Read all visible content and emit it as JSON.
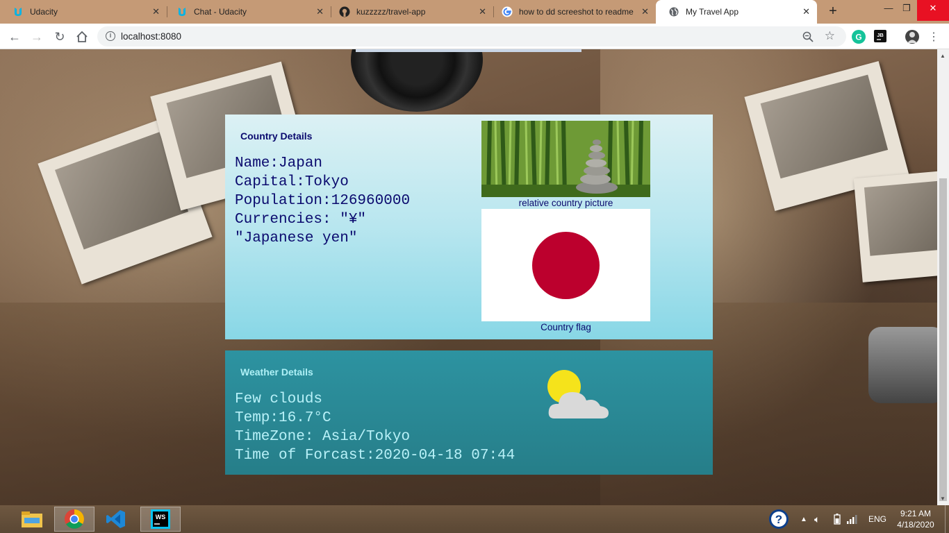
{
  "browser": {
    "tabs": [
      {
        "label": "Udacity",
        "icon": "udacity-icon",
        "active": false
      },
      {
        "label": "Chat - Udacity",
        "icon": "udacity-icon",
        "active": false
      },
      {
        "label": "kuzzzzz/travel-app",
        "icon": "github-icon",
        "active": false
      },
      {
        "label": "how to dd screeshot to readme",
        "icon": "google-icon",
        "active": false
      },
      {
        "label": "My Travel App",
        "icon": "globe-icon",
        "active": true
      }
    ],
    "url": "localhost:8080"
  },
  "country": {
    "heading": "Country Details",
    "name_line": "Name:Japan",
    "capital_line": "Capital:Tokyo",
    "population_line": "Population:126960000",
    "currencies_line1": "Currencies: \"¥\"",
    "currencies_line2": "\"Japanese yen\"",
    "picture_caption": "relative country picture",
    "flag_caption": "Country flag"
  },
  "weather": {
    "heading": "Weather Details",
    "description": "Few clouds",
    "temp_line": "Temp:16.7°C",
    "timezone_line": "TimeZone: Asia/Tokyo",
    "forecast_line": "Time of Forcast:2020-04-18 07:44",
    "icon": "sun-behind-cloud-icon"
  },
  "taskbar": {
    "apps": [
      "file-explorer-icon",
      "chrome-icon",
      "vscode-icon",
      "webstorm-icon"
    ],
    "language": "ENG",
    "time": "9:21 AM",
    "date": "4/18/2020"
  },
  "colors": {
    "country_text": "#0a0a6e",
    "weather_bg": "#2a8a97",
    "flag_red": "#bc002d"
  }
}
